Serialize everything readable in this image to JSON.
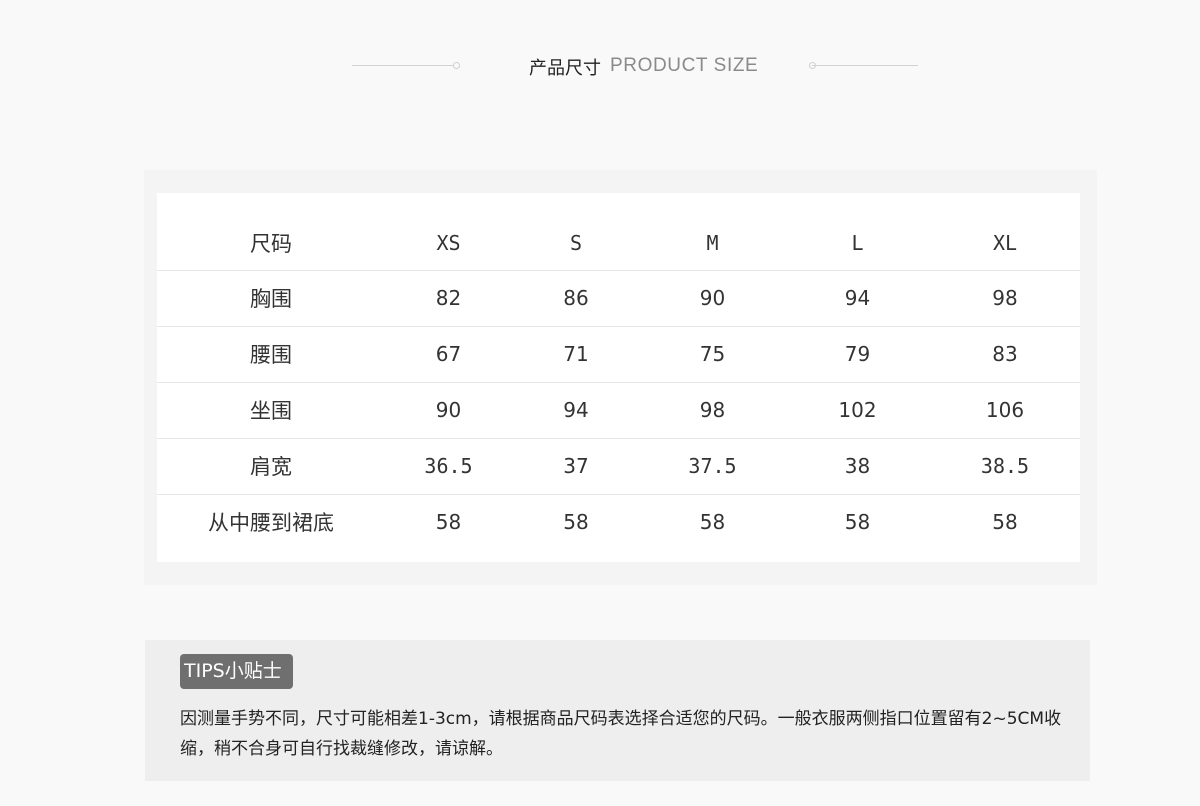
{
  "header": {
    "title_zh": "产品尺寸",
    "title_en": "PRODUCT SIZE"
  },
  "size_table": {
    "header": {
      "label": "尺码",
      "sizes": [
        "XS",
        "S",
        "M",
        "L",
        "XL"
      ]
    },
    "rows": [
      {
        "label": "胸围",
        "values": [
          "82",
          "86",
          "90",
          "94",
          "98"
        ]
      },
      {
        "label": "腰围",
        "values": [
          "67",
          "71",
          "75",
          "79",
          "83"
        ]
      },
      {
        "label": "坐围",
        "values": [
          "90",
          "94",
          "98",
          "102",
          "106"
        ]
      },
      {
        "label": "肩宽",
        "values": [
          "36.5",
          "37",
          "37.5",
          "38",
          "38.5"
        ]
      },
      {
        "label": "从中腰到裙底",
        "values": [
          "58",
          "58",
          "58",
          "58",
          "58"
        ]
      }
    ]
  },
  "tips": {
    "badge": "TIPS小贴士",
    "text": "因测量手势不同，尺寸可能相差1-3cm，请根据商品尺码表选择合适您的尺码。一般衣服两侧指口位置留有2~5CM收缩，稍不合身可自行找裁缝修改，请谅解。"
  },
  "colors": {
    "page_background": "#f9f9f9",
    "table_background": "#ffffff",
    "tips_background": "#eeeeee",
    "badge_background": "#6f6f6f"
  }
}
